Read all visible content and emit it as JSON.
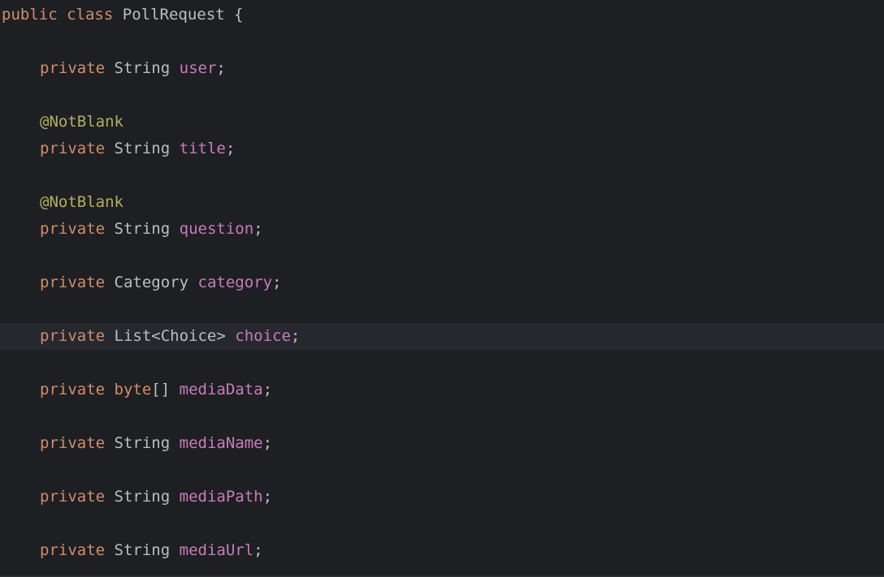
{
  "editor": {
    "class_decl": {
      "kw_public": "public",
      "kw_class": "class",
      "name": "PollRequest",
      "brace": "{"
    },
    "fields": [
      {
        "modifier": "private",
        "type": "String",
        "name": "user",
        "semi": ";"
      },
      {
        "annotation": "@NotBlank"
      },
      {
        "modifier": "private",
        "type": "String",
        "name": "title",
        "semi": ";"
      },
      {
        "annotation": "@NotBlank"
      },
      {
        "modifier": "private",
        "type": "String",
        "name": "question",
        "semi": ";"
      },
      {
        "modifier": "private",
        "type": "Category",
        "name": "category",
        "semi": ";"
      },
      {
        "modifier": "private",
        "type": "List<Choice>",
        "name": "choice",
        "semi": ";"
      },
      {
        "modifier": "private",
        "type_kw": "byte",
        "type_suffix": "[]",
        "name": "mediaData",
        "semi": ";"
      },
      {
        "modifier": "private",
        "type": "String",
        "name": "mediaName",
        "semi": ";"
      },
      {
        "modifier": "private",
        "type": "String",
        "name": "mediaPath",
        "semi": ";"
      },
      {
        "modifier": "private",
        "type": "String",
        "name": "mediaUrl",
        "semi": ";"
      }
    ],
    "colors": {
      "background": "#1e1f22",
      "current_line": "#26282e",
      "keyword": "#cf8e6d",
      "identifier": "#bcbec4",
      "field": "#c77dbb",
      "annotation": "#b3ae60"
    }
  }
}
